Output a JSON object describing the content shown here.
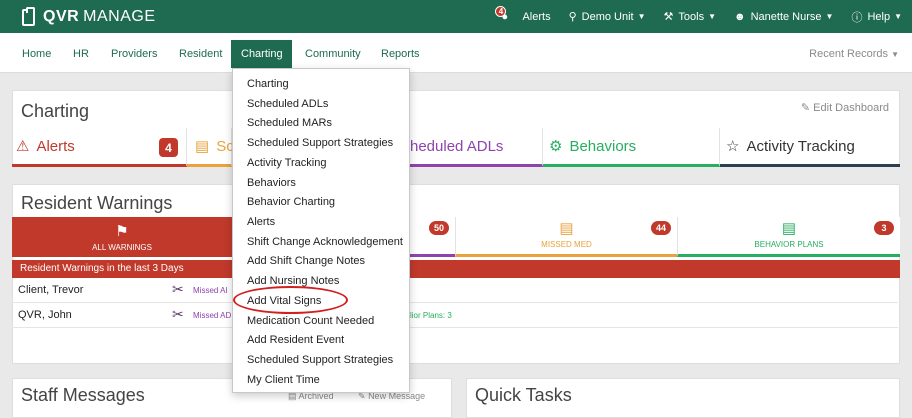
{
  "app": {
    "brand_bold": "QVR",
    "brand_light": "MANAGE"
  },
  "topbar": {
    "alerts_count": "4",
    "alerts_label": "Alerts",
    "unit_label": "Demo Unit",
    "tools_label": "Tools",
    "user_label": "Nanette Nurse",
    "help_label": "Help"
  },
  "nav": {
    "items": [
      "Home",
      "HR",
      "Providers",
      "Resident",
      "Charting",
      "Community",
      "Reports"
    ],
    "active": "Charting",
    "recent_records": "Recent Records"
  },
  "charting_card": {
    "title": "Charting",
    "edit_label": "Edit Dashboard",
    "tiles": [
      {
        "label": "Alerts",
        "icon": "warning-triangle-icon",
        "badge": "4",
        "color": "#c0392b"
      },
      {
        "label": "Sc",
        "icon": "clipboard-icon",
        "color": "#e8a33d"
      },
      {
        "label": "heduled ADLs",
        "color": "#8e44ad"
      },
      {
        "label": "Behaviors",
        "icon": "behaviors-icon",
        "color": "#27ae60"
      },
      {
        "label": "Activity Tracking",
        "icon": "star-icon",
        "color": "#2c3e50"
      }
    ]
  },
  "warnings_card": {
    "title": "Resident Warnings",
    "tabs": [
      {
        "label": "ALL WARNINGS",
        "icon": "flag-icon"
      },
      {
        "label": "",
        "badge": "50"
      },
      {
        "label": "MISSED MED",
        "badge": "44",
        "icon": "med-icon"
      },
      {
        "label": "BEHAVIOR PLANS",
        "badge": "3",
        "icon": "behavior-plan-icon"
      }
    ],
    "banner": "Resident Warnings in the last 3 Days",
    "rows": [
      {
        "name": "Client, Trevor",
        "missed": "Missed AI",
        "extra": ""
      },
      {
        "name": "QVR, John",
        "missed": "Missed AD",
        "extra": "lior Plans: 3"
      }
    ]
  },
  "bottom": {
    "staff_messages": "Staff Messages",
    "archived": "Archived",
    "new_message": "New Message",
    "quick_tasks": "Quick Tasks"
  },
  "dropdown": {
    "items": [
      "Charting",
      "Scheduled ADLs",
      "Scheduled MARs",
      "Scheduled Support Strategies",
      "Activity Tracking",
      "Behaviors",
      "Behavior Charting",
      "Alerts",
      "Shift Change Acknowledgement",
      "Add Shift Change Notes",
      "Add Nursing Notes",
      "Add Vital Signs",
      "Medication Count Needed",
      "Add Resident Event",
      "Scheduled Support Strategies",
      "My Client Time"
    ],
    "highlighted": "Add Vital Signs"
  },
  "colors": {
    "brand": "#1e6b52",
    "alert": "#c0392b",
    "highlight_circle": "#d21f1f"
  }
}
